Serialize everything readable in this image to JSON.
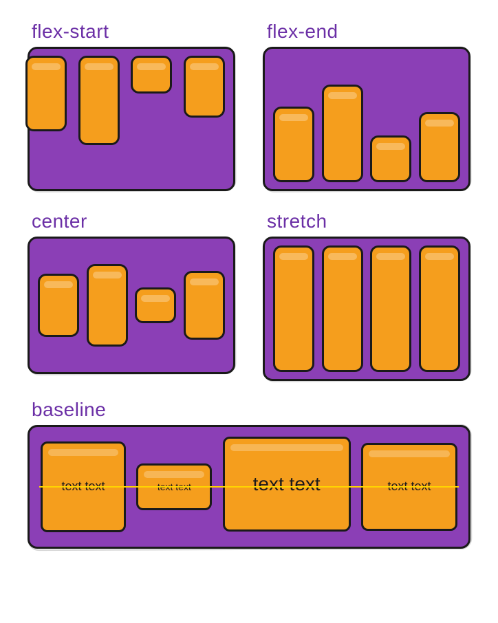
{
  "panels": {
    "flex_start": {
      "title": "flex-start"
    },
    "flex_end": {
      "title": "flex-end"
    },
    "center": {
      "title": "center"
    },
    "stretch": {
      "title": "stretch"
    },
    "baseline": {
      "title": "baseline",
      "items": [
        {
          "text": "text text"
        },
        {
          "text": "text text"
        },
        {
          "text": "text text"
        },
        {
          "text": "text text"
        }
      ]
    }
  },
  "colors": {
    "container": "#8b3fb6",
    "item": "#f59e1d",
    "stroke": "#1a1a1a",
    "title": "#6b2fa6",
    "baseline_line": "#ffd400"
  }
}
